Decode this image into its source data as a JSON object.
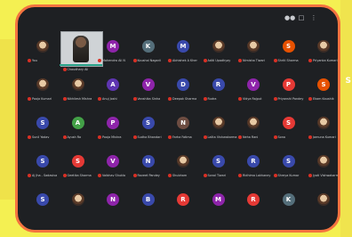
{
  "window": {
    "title": ""
  },
  "edge_text": "S",
  "toolbar": {
    "icons": [
      "people-icon",
      "chat-icon",
      "more-icon"
    ]
  },
  "participants": [
    {
      "name": "You",
      "initial": "",
      "color": "#6b7078",
      "photo": true
    },
    {
      "name": "Chaudhary Ali",
      "initial": "",
      "color": "#6b7078",
      "video": true
    },
    {
      "name": "Mahendra Ali N",
      "initial": "M",
      "color": "#8e24aa"
    },
    {
      "name": "Koushal Nagarii",
      "initial": "K",
      "color": "#546e7a"
    },
    {
      "name": "Abhishek A Kher",
      "initial": "M",
      "color": "#3949ab"
    },
    {
      "name": "Aditi Upadhyay",
      "initial": "",
      "color": "#6b7078",
      "photo": true
    },
    {
      "name": "Nimisha Tiwari",
      "initial": "",
      "color": "#6b7078",
      "photo": true
    },
    {
      "name": "Shriti Sharma",
      "initial": "S",
      "color": "#e65100"
    },
    {
      "name": "Priyanka Kumari",
      "initial": "",
      "color": "#6b7078",
      "photo": true
    },
    {
      "name": "Pooja Kumari",
      "initial": "",
      "color": "#6b7078",
      "photo": true
    },
    {
      "name": "Nikhilesh Mishra",
      "initial": "",
      "color": "#6b7078",
      "photo": true
    },
    {
      "name": "Anuj Joshi",
      "initial": "A",
      "color": "#5e35b1"
    },
    {
      "name": "Vanshika Sinha",
      "initial": "V",
      "color": "#8e24aa"
    },
    {
      "name": "Deepak Sharma",
      "initial": "D",
      "color": "#3949ab"
    },
    {
      "name": "Rudra",
      "initial": "R",
      "color": "#3949ab"
    },
    {
      "name": "Vidya Rajput",
      "initial": "V",
      "color": "#8e24aa"
    },
    {
      "name": "Priyanshi Pandey",
      "initial": "P",
      "color": "#e53935"
    },
    {
      "name": "Ekam Kaushik",
      "initial": "S",
      "color": "#e65100"
    },
    {
      "name": "Sunil Yadav",
      "initial": "S",
      "color": "#3949ab"
    },
    {
      "name": "Ayush Ra",
      "initial": "A",
      "color": "#43a047"
    },
    {
      "name": "Pooja Mishra",
      "initial": "P",
      "color": "#8e24aa"
    },
    {
      "name": "Sudha Bhandari",
      "initial": "S",
      "color": "#3949ab"
    },
    {
      "name": "Farha Fatima",
      "initial": "N",
      "color": "#6d4c41"
    },
    {
      "name": "Lalita Vishwakarma",
      "initial": "",
      "color": "#6b7078",
      "photo": true
    },
    {
      "name": "Neha Rani",
      "initial": "",
      "color": "#6b7078",
      "photo": true
    },
    {
      "name": "Sona",
      "initial": "S",
      "color": "#e53935"
    },
    {
      "name": "Jamuna Kumari",
      "initial": "",
      "color": "#6b7078",
      "photo": true
    },
    {
      "name": "Aj Jha - Sadasiva",
      "initial": "S",
      "color": "#3949ab"
    },
    {
      "name": "Geetika Sharma",
      "initial": "S",
      "color": "#e53935"
    },
    {
      "name": "Vaibhav Shukla",
      "initial": "V",
      "color": "#8e24aa"
    },
    {
      "name": "Raveet Pandey",
      "initial": "N",
      "color": "#3949ab"
    },
    {
      "name": "Shubham",
      "initial": "",
      "color": "#6b7078",
      "photo": true
    },
    {
      "name": "Sonal Tiwari",
      "initial": "S",
      "color": "#3949ab"
    },
    {
      "name": "Ridhima Lakhaney",
      "initial": "R",
      "color": "#3949ab"
    },
    {
      "name": "Shreya Kumar",
      "initial": "S",
      "color": "#3949ab"
    },
    {
      "name": "Jyoti Vishwakarma",
      "initial": "",
      "color": "#6b7078",
      "photo": true
    },
    {
      "name": "",
      "initial": "S",
      "color": "#3949ab"
    },
    {
      "name": "",
      "initial": "",
      "color": "#6b7078",
      "photo": true
    },
    {
      "name": "",
      "initial": "N",
      "color": "#8e24aa"
    },
    {
      "name": "",
      "initial": "B",
      "color": "#3949ab"
    },
    {
      "name": "",
      "initial": "R",
      "color": "#e53935"
    },
    {
      "name": "",
      "initial": "M",
      "color": "#8e24aa"
    },
    {
      "name": "",
      "initial": "R",
      "color": "#e53935"
    },
    {
      "name": "",
      "initial": "K",
      "color": "#546e7a"
    },
    {
      "name": "",
      "initial": "",
      "color": "#6b7078",
      "photo": true
    }
  ]
}
